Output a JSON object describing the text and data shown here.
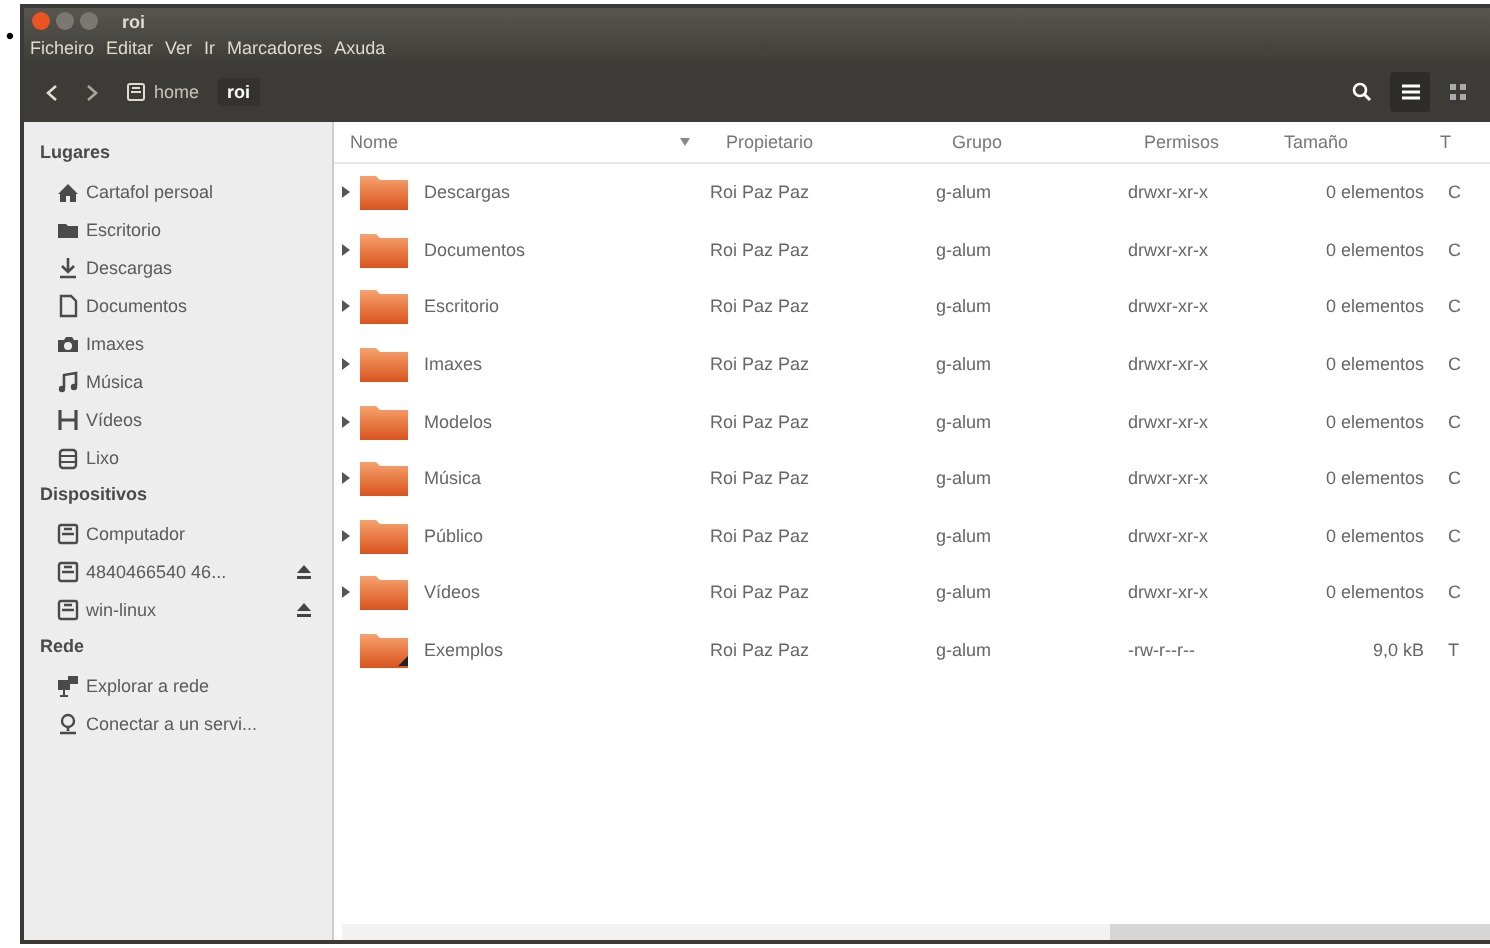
{
  "page": {
    "bullet": "•"
  },
  "window": {
    "title": "roi"
  },
  "menu": [
    "Ficheiro",
    "Editar",
    "Ver",
    "Ir",
    "Marcadores",
    "Axuda"
  ],
  "toolbar": {
    "path": [
      {
        "label": "home",
        "kind": "drive",
        "selected": false
      },
      {
        "label": "roi",
        "kind": "plain",
        "selected": true
      }
    ],
    "views": [
      {
        "kind": "list",
        "selected": true
      },
      {
        "kind": "grid",
        "selected": false
      }
    ]
  },
  "sidebar": [
    {
      "title": "Lugares",
      "items": [
        {
          "label": "Cartafol persoal",
          "kind": "home",
          "eject": false
        },
        {
          "label": "Escritorio",
          "kind": "folder",
          "eject": false
        },
        {
          "label": "Descargas",
          "kind": "download",
          "eject": false
        },
        {
          "label": "Documentos",
          "kind": "document",
          "eject": false
        },
        {
          "label": "Imaxes",
          "kind": "camera",
          "eject": false
        },
        {
          "label": "Música",
          "kind": "music",
          "eject": false
        },
        {
          "label": "Vídeos",
          "kind": "film",
          "eject": false
        },
        {
          "label": "Lixo",
          "kind": "trash",
          "eject": false
        }
      ]
    },
    {
      "title": "Dispositivos",
      "items": [
        {
          "label": "Computador",
          "kind": "drive",
          "eject": false
        },
        {
          "label": "4840466540 46...",
          "kind": "drive",
          "eject": true
        },
        {
          "label": "win-linux",
          "kind": "drive",
          "eject": true
        }
      ]
    },
    {
      "title": "Rede",
      "items": [
        {
          "label": "Explorar a rede",
          "kind": "network",
          "eject": false
        },
        {
          "label": "Conectar a un servi...",
          "kind": "server",
          "eject": false
        }
      ]
    }
  ],
  "table": {
    "columns": [
      {
        "label": "Nome",
        "sorted": true
      },
      {
        "label": "Propietario",
        "sorted": false
      },
      {
        "label": "Grupo",
        "sorted": false
      },
      {
        "label": "Permisos",
        "sorted": false
      },
      {
        "label": "Tamaño",
        "sorted": false
      },
      {
        "label": "T",
        "sorted": false
      }
    ],
    "rows": [
      {
        "name": "Descargas",
        "kind": "folder",
        "expandable": true,
        "owner": "Roi Paz Paz",
        "group": "g-alum",
        "permissions": "drwxr-xr-x",
        "size": "0 elementos",
        "type": "C"
      },
      {
        "name": "Documentos",
        "kind": "folder",
        "expandable": true,
        "owner": "Roi Paz Paz",
        "group": "g-alum",
        "permissions": "drwxr-xr-x",
        "size": "0 elementos",
        "type": "C"
      },
      {
        "name": "Escritorio",
        "kind": "folder",
        "expandable": true,
        "owner": "Roi Paz Paz",
        "group": "g-alum",
        "permissions": "drwxr-xr-x",
        "size": "0 elementos",
        "type": "C"
      },
      {
        "name": "Imaxes",
        "kind": "folder",
        "expandable": true,
        "owner": "Roi Paz Paz",
        "group": "g-alum",
        "permissions": "drwxr-xr-x",
        "size": "0 elementos",
        "type": "C"
      },
      {
        "name": "Modelos",
        "kind": "folder",
        "expandable": true,
        "owner": "Roi Paz Paz",
        "group": "g-alum",
        "permissions": "drwxr-xr-x",
        "size": "0 elementos",
        "type": "C"
      },
      {
        "name": "Música",
        "kind": "folder",
        "expandable": true,
        "owner": "Roi Paz Paz",
        "group": "g-alum",
        "permissions": "drwxr-xr-x",
        "size": "0 elementos",
        "type": "C"
      },
      {
        "name": "Público",
        "kind": "folder",
        "expandable": true,
        "owner": "Roi Paz Paz",
        "group": "g-alum",
        "permissions": "drwxr-xr-x",
        "size": "0 elementos",
        "type": "C"
      },
      {
        "name": "Vídeos",
        "kind": "folder",
        "expandable": true,
        "owner": "Roi Paz Paz",
        "group": "g-alum",
        "permissions": "drwxr-xr-x",
        "size": "0 elementos",
        "type": "C"
      },
      {
        "name": "Exemplos",
        "kind": "link",
        "expandable": false,
        "owner": "Roi Paz Paz",
        "group": "g-alum",
        "permissions": "-rw-r--r--",
        "size": "9,0 kB",
        "type": "T"
      }
    ]
  }
}
